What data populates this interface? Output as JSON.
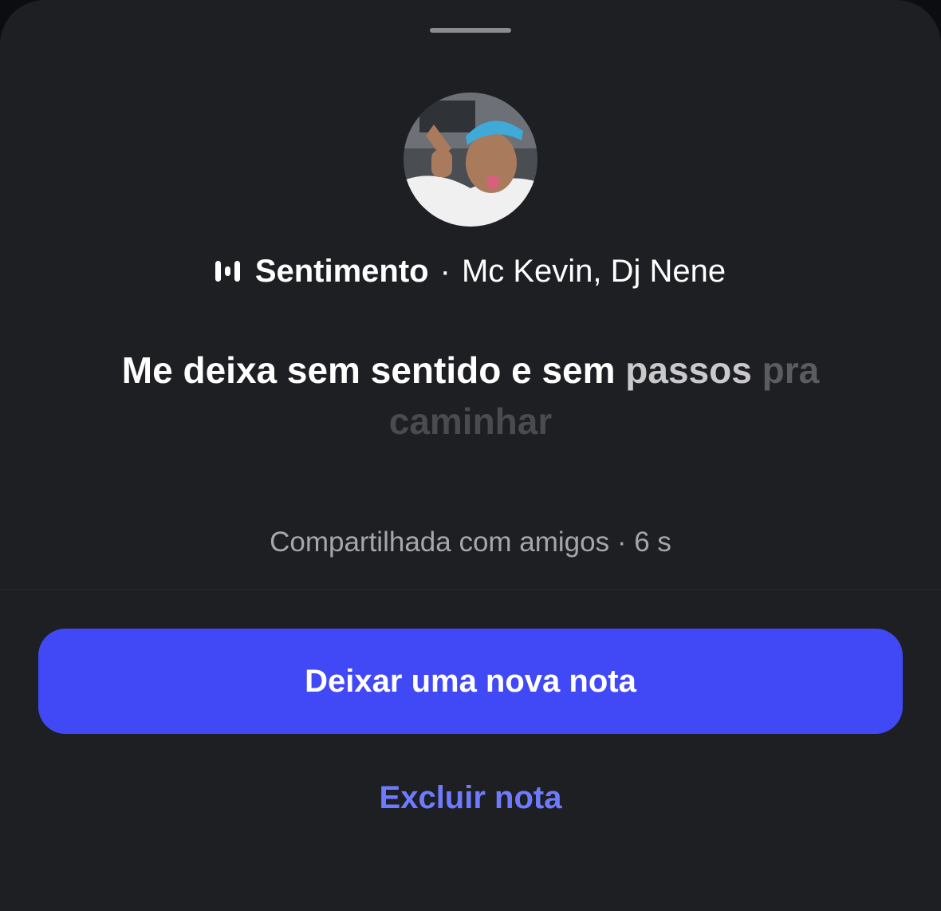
{
  "note": {
    "song": {
      "icon": "music-bars-icon",
      "title": "Sentimento",
      "separator": "·",
      "artist": "Mc Kevin, Dj Nene"
    },
    "lyric_words": [
      {
        "text": "Me deixa sem sentido e sem ",
        "tone": "bright"
      },
      {
        "text": "passos",
        "tone": "mid"
      },
      {
        "text": " pra",
        "tone": "dim"
      },
      {
        "text": "caminhar",
        "tone": "faint"
      }
    ],
    "meta": "Compartilhada com amigos · 6 s"
  },
  "actions": {
    "primary_label": "Deixar uma nova nota",
    "delete_label": "Excluir nota"
  },
  "colors": {
    "sheet_bg": "#1e1f23",
    "primary_button": "#4049f5",
    "link": "#6f7bff"
  }
}
